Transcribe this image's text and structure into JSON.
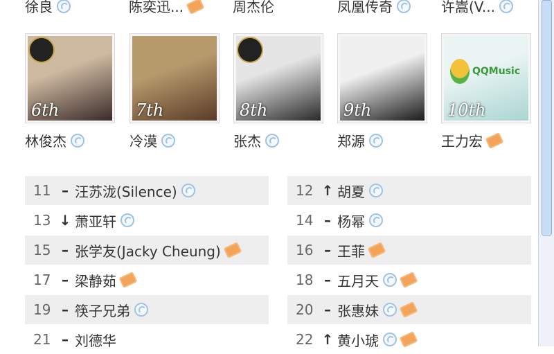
{
  "top_names": [
    {
      "name": "徐良",
      "icon": "play"
    },
    {
      "name": "陈奕迅...",
      "icon": "ticket"
    },
    {
      "name": "周杰伦",
      "icon": ""
    },
    {
      "name": "凤凰传奇",
      "icon": "play"
    },
    {
      "name": "许嵩(V...",
      "icon": "play"
    }
  ],
  "cards": [
    {
      "rank": "6th",
      "name": "林俊杰",
      "icon": "play",
      "colors": [
        "#cdb9a0",
        "#3a2a2a"
      ]
    },
    {
      "rank": "7th",
      "name": "冷漠",
      "icon": "play",
      "colors": [
        "#b79a6c",
        "#5a3b28"
      ]
    },
    {
      "rank": "8th",
      "name": "张杰",
      "icon": "play",
      "colors": [
        "#e5e5e5",
        "#2a2a2a"
      ]
    },
    {
      "rank": "9th",
      "name": "郑源",
      "icon": "play",
      "colors": [
        "#f0f0f0",
        "#1b1b1b"
      ]
    },
    {
      "rank": "10th",
      "name": "王力宏",
      "icon": "ticket",
      "colors": [
        "#e9f4f3",
        "#a9d5d2"
      ],
      "logo_text": "QQMusic"
    }
  ],
  "ranks": [
    {
      "num": "11",
      "trend": "–",
      "name": "汪苏泷(Silence)",
      "icons": [
        "play"
      ]
    },
    {
      "num": "12",
      "trend": "↑",
      "name": "胡夏",
      "icons": [
        "play"
      ]
    },
    {
      "num": "13",
      "trend": "↓",
      "name": "萧亚轩",
      "icons": [
        "play"
      ]
    },
    {
      "num": "14",
      "trend": "–",
      "name": "杨幂",
      "icons": [
        "play"
      ]
    },
    {
      "num": "15",
      "trend": "–",
      "name": "张学友(Jacky Cheung)",
      "icons": [
        "ticket"
      ]
    },
    {
      "num": "16",
      "trend": "–",
      "name": "王菲",
      "icons": [
        "ticket"
      ]
    },
    {
      "num": "17",
      "trend": "–",
      "name": "梁静茹",
      "icons": [
        "ticket"
      ]
    },
    {
      "num": "18",
      "trend": "–",
      "name": "五月天",
      "icons": [
        "play",
        "ticket"
      ]
    },
    {
      "num": "19",
      "trend": "–",
      "name": "筷子兄弟",
      "icons": [
        "play"
      ]
    },
    {
      "num": "20",
      "trend": "–",
      "name": "张惠妹",
      "icons": [
        "play",
        "ticket"
      ]
    },
    {
      "num": "21",
      "trend": "–",
      "name": "刘德华",
      "icons": []
    },
    {
      "num": "22",
      "trend": "↑",
      "name": "黄小琥",
      "icons": [
        "play",
        "ticket"
      ]
    }
  ]
}
